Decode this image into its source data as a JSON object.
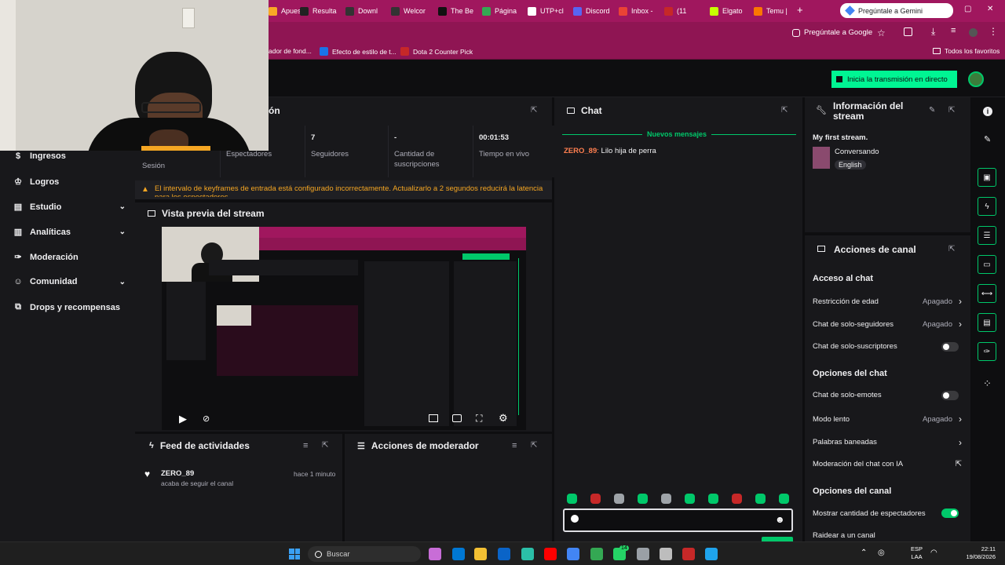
{
  "browser": {
    "tabs": [
      {
        "label": "Apuest",
        "color": "#f9a825"
      },
      {
        "label": "Resulta",
        "color": "#222"
      },
      {
        "label": "Downl",
        "color": "#333"
      },
      {
        "label": "Welcor",
        "color": "#333"
      },
      {
        "label": "The Be",
        "color": "#111"
      },
      {
        "label": "Página",
        "color": "#34a853"
      },
      {
        "label": "UTP+cl",
        "color": "#fff"
      },
      {
        "label": "Discord",
        "color": "#5865f2"
      },
      {
        "label": "Inbox -",
        "color": "#ea4335"
      },
      {
        "label": "(11",
        "color": "#c62828"
      },
      {
        "label": "Elgato",
        "color": "#c6ff00"
      },
      {
        "label": "Temu |",
        "color": "#fb7701"
      }
    ],
    "new_tab": "+",
    "gemini_tab": "Pregúntale a Gemini",
    "ask_google": "Pregúntale a Google",
    "bookmarks": [
      {
        "label": "ador de fond..."
      },
      {
        "label": "Efecto de estilo de t..."
      },
      {
        "label": "Dota 2 Counter Pick"
      }
    ],
    "all_bookmarks": "Todos los favoritos"
  },
  "topnav": {
    "go_live": "Inicia la transmisión en directo"
  },
  "sidebar": {
    "items": [
      {
        "label": "Ingresos",
        "chev": false
      },
      {
        "label": "Logros",
        "chev": false
      },
      {
        "label": "Estudio",
        "chev": true
      },
      {
        "label": "Analíticas",
        "chev": true
      },
      {
        "label": "Moderación",
        "chev": false
      },
      {
        "label": "Comunidad",
        "chev": true
      },
      {
        "label": "Drops y recompensas",
        "chev": false
      }
    ]
  },
  "session": {
    "title_partial": "ón",
    "stats": [
      {
        "value": "",
        "label": "Sesión"
      },
      {
        "value": "",
        "label": "Espectadores"
      },
      {
        "value": "7",
        "label": "Seguidores"
      },
      {
        "value": "-",
        "label": "Cantidad de suscripciones"
      },
      {
        "value": "00:01:53",
        "label": "Tiempo en vivo"
      }
    ],
    "warning": "El intervalo de keyframes de entrada está configurado incorrectamente. Actualizarlo a 2 segundos reducirá la latencia para los espectadores."
  },
  "preview": {
    "title": "Vista previa del stream"
  },
  "feed": {
    "title": "Feed de actividades",
    "items": [
      {
        "user": "ZERO_89",
        "action": "acaba de seguir el canal",
        "time": "hace 1 minuto"
      }
    ]
  },
  "mod_actions": {
    "title": "Acciones de moderador"
  },
  "chat": {
    "title": "Chat",
    "new_messages": "Nuevos mensajes",
    "messages": [
      {
        "user": "ZERO_89",
        "text": "Lilo hija de perra",
        "color": "#ff7f50"
      }
    ],
    "input_placeholder": ""
  },
  "stream_info": {
    "title": "Información del stream",
    "stream_title": "My first stream.",
    "category": "Conversando",
    "language": "English"
  },
  "channel_actions": {
    "title": "Acciones de canal",
    "sections": [
      {
        "heading": "Acceso al chat",
        "rows": [
          {
            "label": "Restricción de edad",
            "value": "Apagado",
            "control": "chevron"
          },
          {
            "label": "Chat de solo-seguidores",
            "value": "Apagado",
            "control": "chevron"
          },
          {
            "label": "Chat de solo-suscriptores",
            "value": "",
            "control": "toggle-off"
          }
        ]
      },
      {
        "heading": "Opciones del chat",
        "rows": [
          {
            "label": "Chat de solo-emotes",
            "value": "",
            "control": "toggle-off"
          },
          {
            "label": "Modo lento",
            "value": "Apagado",
            "control": "chevron"
          },
          {
            "label": "Palabras baneadas",
            "value": "",
            "control": "chevron"
          },
          {
            "label": "Moderación del chat con IA",
            "value": "",
            "control": "external"
          }
        ]
      },
      {
        "heading": "Opciones del canal",
        "rows": [
          {
            "label": "Mostrar cantidad de espectadores",
            "value": "",
            "control": "toggle-on"
          },
          {
            "label": "Raidear a un canal",
            "value": "",
            "control": "none"
          }
        ]
      }
    ]
  },
  "taskbar": {
    "search": "Buscar",
    "lang1": "ESP",
    "lang2": "LAA",
    "time": "22:11",
    "date": "19/08/2026",
    "badge": "14"
  },
  "colors": {
    "accent": "#00c86a",
    "brand": "#a0175e",
    "twitch_green": "#00f593"
  }
}
